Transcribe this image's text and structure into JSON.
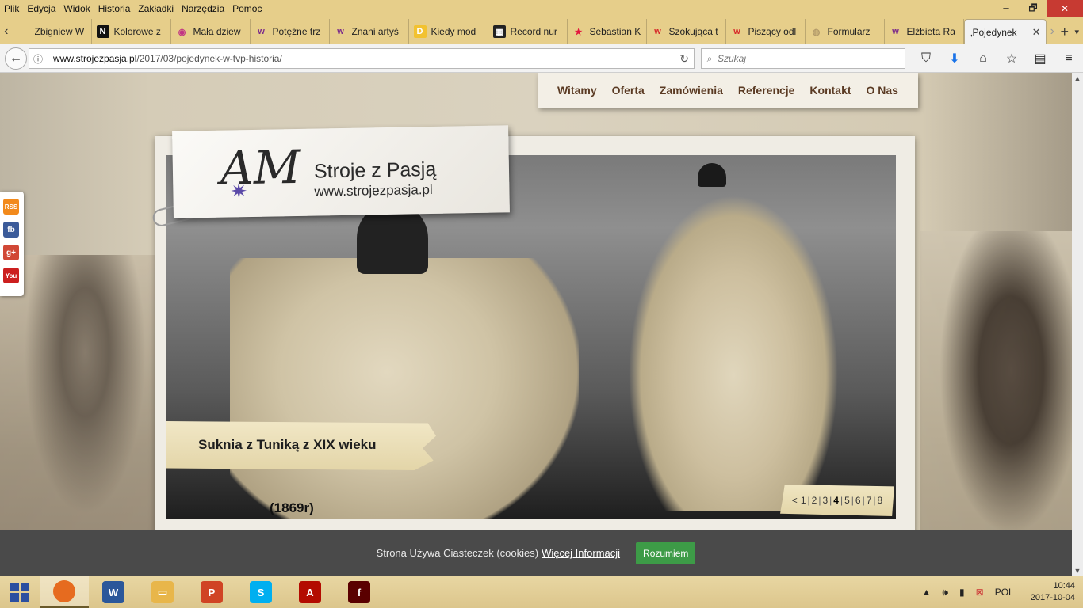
{
  "menubar": {
    "items": [
      "Plik",
      "Edycja",
      "Widok",
      "Historia",
      "Zakładki",
      "Narzędzia",
      "Pomoc"
    ]
  },
  "window_controls": {
    "minimize": "🗕",
    "maximize": "🗗",
    "close": "✕"
  },
  "tabs": [
    {
      "title": "Zbigniew W",
      "icon": "page-icon",
      "fav": "",
      "color": "#cfcfcf"
    },
    {
      "title": "Kolorowe z",
      "icon": "n-logo-icon",
      "fav": "N",
      "color": "#111111"
    },
    {
      "title": "Mała dziew",
      "icon": "instagram-icon",
      "fav": "◉",
      "color": "#c13584"
    },
    {
      "title": "Potężne trz",
      "icon": "wp-logo-icon",
      "fav": "w",
      "color": "#7a2a8a"
    },
    {
      "title": "Znani artyś",
      "icon": "wp-logo-icon",
      "fav": "w",
      "color": "#7a2a8a"
    },
    {
      "title": "Kiedy mod",
      "icon": "d-logo-icon",
      "fav": "D",
      "color": "#f2c230"
    },
    {
      "title": "Record nur",
      "icon": "bbc-logo-icon",
      "fav": "▦",
      "color": "#222222"
    },
    {
      "title": "Sebastian K",
      "icon": "star-icon",
      "fav": "★",
      "color": "#e3173e"
    },
    {
      "title": "Szokująca t",
      "icon": "w-red-logo-icon",
      "fav": "w",
      "color": "#d72a2a"
    },
    {
      "title": "Piszący odl",
      "icon": "w-red-logo-icon",
      "fav": "w",
      "color": "#d72a2a"
    },
    {
      "title": "Formularz",
      "icon": "globe-icon",
      "fav": "◍",
      "color": "#b39b6a"
    },
    {
      "title": "Elżbieta Ra",
      "icon": "wp-logo-icon",
      "fav": "w",
      "color": "#7a2a8a"
    },
    {
      "title": "„Pojedynek",
      "icon": "",
      "fav": "",
      "color": "",
      "active": true
    }
  ],
  "navbar": {
    "url_host": "www.strojezpasja.pl",
    "url_path": "/2017/03/pojedynek-w-tvp-historia/",
    "search_placeholder": "Szukaj"
  },
  "site": {
    "nav": [
      "Witamy",
      "Oferta",
      "Zamówienia",
      "Referencje",
      "Kontakt",
      "O Nas"
    ],
    "logo_monogram": "AM",
    "logo_name": "Stroje z Pasją",
    "logo_site": "www.strojezpasja.pl",
    "slide_caption": "Suknia z Tuniką z XIX wieku",
    "slide_year": "(1869r)",
    "pager": {
      "prev": "<",
      "pages": [
        "1",
        "2",
        "3",
        "4",
        "5",
        "6",
        "7",
        "8"
      ],
      "current": "4"
    },
    "social": [
      {
        "name": "rss",
        "label": "RSS",
        "color": "#f28a1c"
      },
      {
        "name": "facebook",
        "label": "fb",
        "color": "#3b5b9a"
      },
      {
        "name": "google-plus",
        "label": "g+",
        "color": "#d14836"
      },
      {
        "name": "youtube",
        "label": "You",
        "color": "#cc1f1f"
      }
    ]
  },
  "cookie_bar": {
    "text": "Strona Używa Ciasteczek (cookies)",
    "link": "Więcej Informacji",
    "button": "Rozumiem"
  },
  "taskbar": {
    "apps": [
      {
        "name": "firefox",
        "label": "",
        "color": "#e66b1f",
        "active": true
      },
      {
        "name": "word",
        "label": "W",
        "color": "#2b579a"
      },
      {
        "name": "file-explorer",
        "label": "▭",
        "color": "#e8b64a"
      },
      {
        "name": "powerpoint",
        "label": "P",
        "color": "#d04424"
      },
      {
        "name": "skype",
        "label": "S",
        "color": "#00aff0"
      },
      {
        "name": "acrobat",
        "label": "A",
        "color": "#b30b00"
      },
      {
        "name": "flash",
        "label": "f",
        "color": "#5a0000"
      }
    ],
    "language": "POL",
    "time": "10:44",
    "date": "2017-10-04"
  }
}
